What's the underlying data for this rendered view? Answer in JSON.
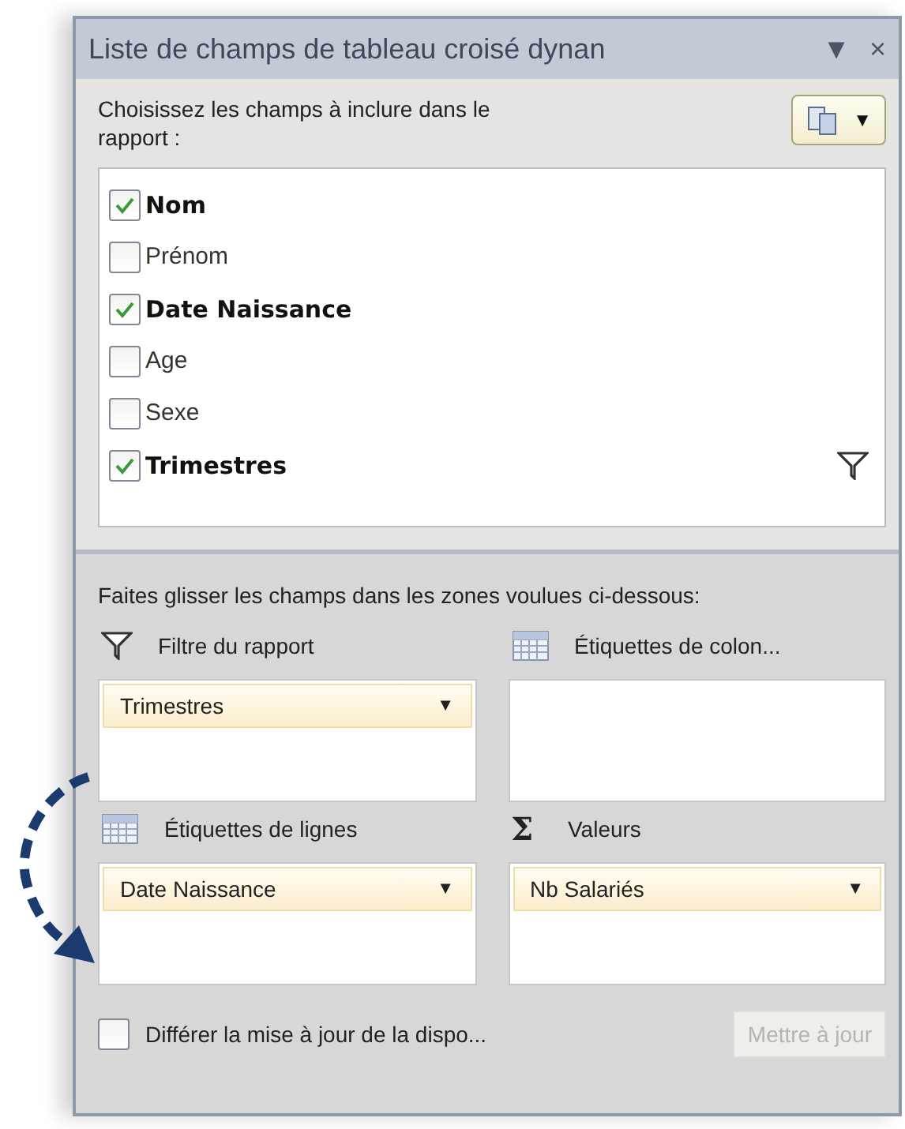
{
  "panel": {
    "title": "Liste de champs de tableau croisé dynan",
    "menu_caret": "▼",
    "close": "×"
  },
  "choose_label": "Choisissez les champs à inclure dans le rapport :",
  "layout_button": {
    "caret": "▼"
  },
  "fields": [
    {
      "name": "Nom",
      "checked": true,
      "filtered": false
    },
    {
      "name": "Prénom",
      "checked": false,
      "filtered": false
    },
    {
      "name": "Date  Naissance",
      "checked": true,
      "filtered": false
    },
    {
      "name": "Age",
      "checked": false,
      "filtered": false
    },
    {
      "name": "Sexe",
      "checked": false,
      "filtered": false
    },
    {
      "name": "Trimestres",
      "checked": true,
      "filtered": true
    }
  ],
  "drag_label": "Faites glisser les champs dans les zones voulues ci-dessous:",
  "zones": [
    {
      "kind": "filter",
      "label": "Filtre du rapport",
      "items": [
        {
          "name": "Trimestres",
          "caret": "▼"
        }
      ]
    },
    {
      "kind": "columns",
      "label": "Étiquettes de colon..."
    },
    {
      "kind": "rows",
      "label": "Étiquettes de lignes",
      "items": [
        {
          "name": "Date  Naissance",
          "caret": "▼"
        }
      ]
    },
    {
      "kind": "values",
      "label": "Valeurs",
      "icon": "Σ",
      "items": [
        {
          "name": "Nb Salariés",
          "caret": "▼"
        }
      ]
    }
  ],
  "defer": {
    "label": "Différer la mise à jour de la dispo...",
    "checked": false
  },
  "update_button": {
    "label": "Mettre à jour",
    "disabled": true
  }
}
